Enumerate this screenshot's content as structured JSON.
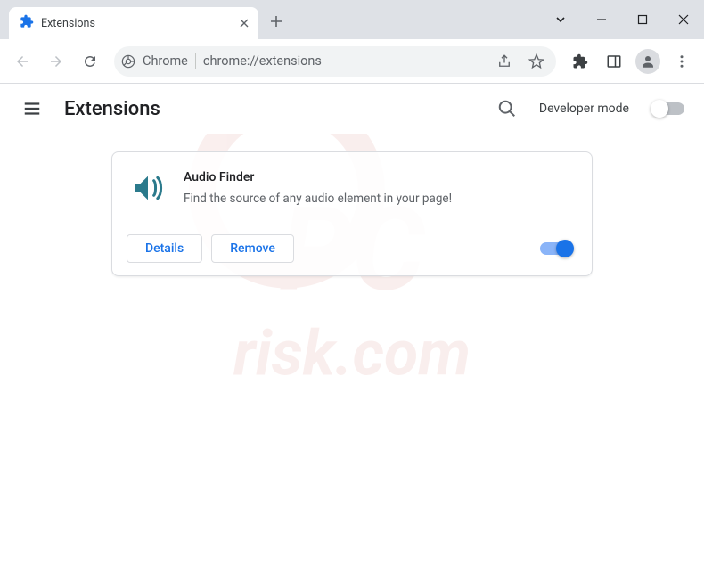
{
  "tab": {
    "title": "Extensions"
  },
  "omnibox": {
    "prefix": "Chrome",
    "url": "chrome://extensions"
  },
  "page": {
    "title": "Extensions",
    "developer_mode_label": "Developer mode"
  },
  "extension": {
    "name": "Audio Finder",
    "description": "Find the source of any audio element in your page!",
    "details_label": "Details",
    "remove_label": "Remove",
    "enabled": true
  }
}
